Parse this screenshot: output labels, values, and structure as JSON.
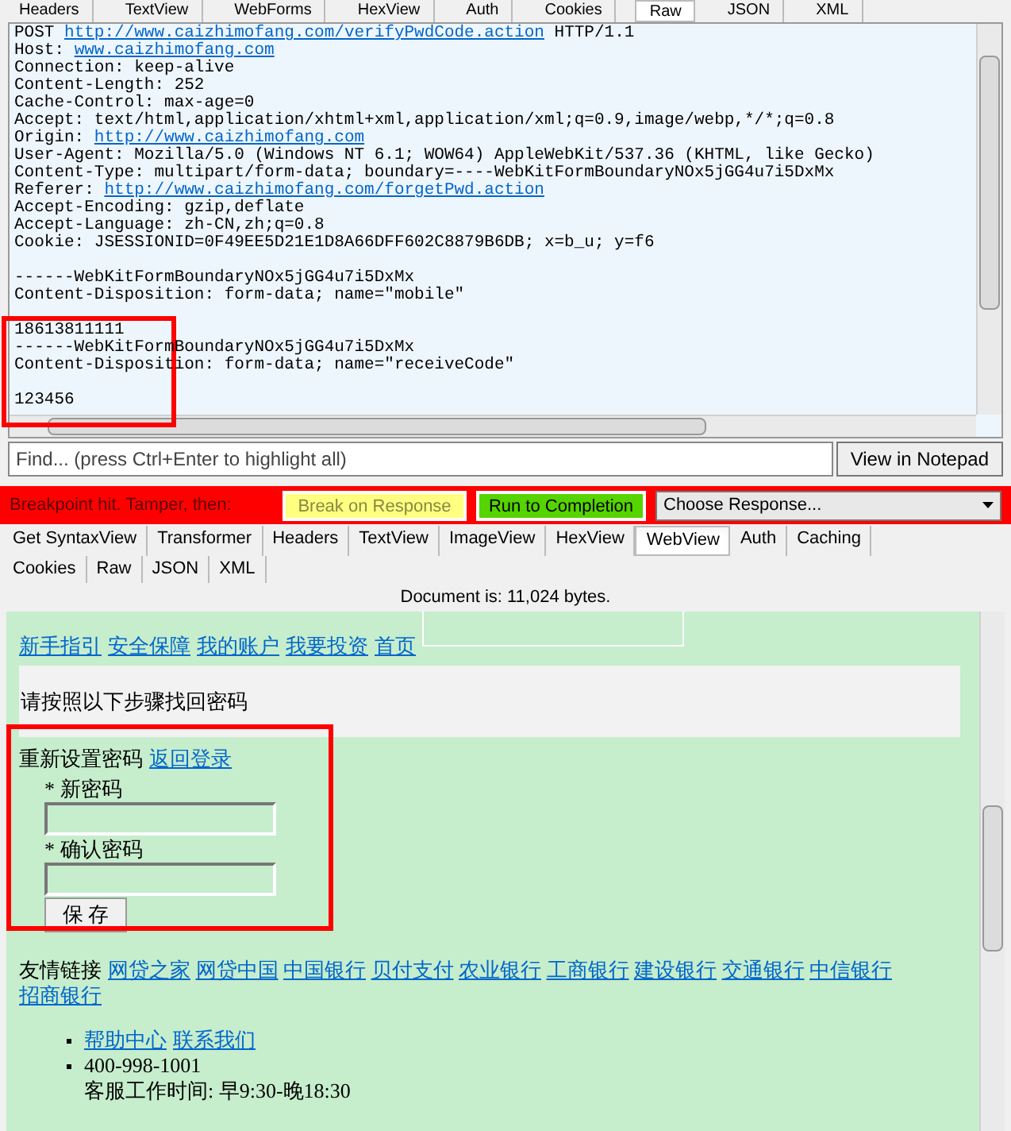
{
  "request_tabs": [
    {
      "label": "Headers",
      "selected": false
    },
    {
      "label": "TextView",
      "selected": false
    },
    {
      "label": "WebForms",
      "selected": false
    },
    {
      "label": "HexView",
      "selected": false
    },
    {
      "label": "Auth",
      "selected": false
    },
    {
      "label": "Cookies",
      "selected": false
    },
    {
      "label": "Raw",
      "selected": true
    },
    {
      "label": "JSON",
      "selected": false
    },
    {
      "label": "XML",
      "selected": false
    }
  ],
  "request_lines": [
    {
      "gap_before": false,
      "parts": [
        {
          "text": "POST ",
          "link": false
        },
        {
          "text": "http://www.caizhimofang.com/verifyPwdCode.action",
          "link": true
        },
        {
          "text": " HTTP/1.1",
          "link": false
        }
      ]
    },
    {
      "gap_before": false,
      "parts": [
        {
          "text": "Host: ",
          "link": false
        },
        {
          "text": "www.caizhimofang.com",
          "link": true
        }
      ]
    },
    {
      "gap_before": false,
      "parts": [
        {
          "text": "Connection: keep-alive",
          "link": false
        }
      ]
    },
    {
      "gap_before": false,
      "parts": [
        {
          "text": "Content-Length: 252",
          "link": false
        }
      ]
    },
    {
      "gap_before": false,
      "parts": [
        {
          "text": "Cache-Control: max-age=0",
          "link": false
        }
      ]
    },
    {
      "gap_before": false,
      "parts": [
        {
          "text": "Accept: text/html,application/xhtml+xml,application/xml;q=0.9,image/webp,*/*;q=0.8",
          "link": false
        }
      ]
    },
    {
      "gap_before": false,
      "parts": [
        {
          "text": "Origin: ",
          "link": false
        },
        {
          "text": "http://www.caizhimofang.com",
          "link": true
        }
      ]
    },
    {
      "gap_before": false,
      "parts": [
        {
          "text": "User-Agent: Mozilla/5.0 (Windows NT 6.1; WOW64) AppleWebKit/537.36 (KHTML, like Gecko)",
          "link": false
        }
      ]
    },
    {
      "gap_before": false,
      "parts": [
        {
          "text": "Content-Type: multipart/form-data; boundary=----WebKitFormBoundaryNOx5jGG4u7i5DxMx",
          "link": false
        }
      ]
    },
    {
      "gap_before": false,
      "parts": [
        {
          "text": "Referer: ",
          "link": false
        },
        {
          "text": "http://www.caizhimofang.com/forgetPwd.action",
          "link": true
        }
      ]
    },
    {
      "gap_before": false,
      "parts": [
        {
          "text": "Accept-Encoding: gzip,deflate",
          "link": false
        }
      ]
    },
    {
      "gap_before": false,
      "parts": [
        {
          "text": "Accept-Language: zh-CN,zh;q=0.8",
          "link": false
        }
      ]
    },
    {
      "gap_before": false,
      "parts": [
        {
          "text": "Cookie: JSESSIONID=0F49EE5D21E1D8A66DFF602C8879B6DB; x=b_u; y=f6",
          "link": false
        }
      ]
    },
    {
      "gap_before": true,
      "parts": [
        {
          "text": "------WebKitFormBoundaryNOx5jGG4u7i5DxMx",
          "link": false
        }
      ]
    },
    {
      "gap_before": false,
      "parts": [
        {
          "text": "Content-Disposition: form-data; name=\"mobile\"",
          "link": false
        }
      ]
    },
    {
      "gap_before": true,
      "parts": [
        {
          "text": "18613811111",
          "link": false
        }
      ]
    },
    {
      "gap_before": false,
      "parts": [
        {
          "text": "------WebKitFormBoundaryNOx5jGG4u7i5DxMx",
          "link": false
        }
      ]
    },
    {
      "gap_before": false,
      "parts": [
        {
          "text": "Content-Disposition: form-data; name=\"receiveCode\"",
          "link": false
        }
      ]
    },
    {
      "gap_before": true,
      "parts": [
        {
          "text": "123456",
          "link": false
        }
      ]
    }
  ],
  "find": {
    "placeholder": "Find... (press Ctrl+Enter to highlight all)",
    "button": "View in Notepad"
  },
  "breakpoint": {
    "message": "Breakpoint hit. Tamper, then:",
    "break_on_response": {
      "label": "Break on Response",
      "disabled": true
    },
    "run_to_completion": "Run to Completion",
    "choose_response": "Choose Response..."
  },
  "response_tabs": [
    [
      {
        "label": "Get SyntaxView",
        "selected": false
      },
      {
        "label": "Transformer",
        "selected": false
      },
      {
        "label": "Headers",
        "selected": false
      },
      {
        "label": "TextView",
        "selected": false
      },
      {
        "label": "ImageView",
        "selected": false
      },
      {
        "label": "HexView",
        "selected": false
      },
      {
        "label": "WebView",
        "selected": true
      },
      {
        "label": "Auth",
        "selected": false
      },
      {
        "label": "Caching",
        "selected": false
      }
    ],
    [
      {
        "label": "Cookies",
        "selected": false
      },
      {
        "label": "Raw",
        "selected": false
      },
      {
        "label": "JSON",
        "selected": false
      },
      {
        "label": "XML",
        "selected": false
      }
    ]
  ],
  "document_size": "Document is: 11,024 bytes.",
  "webview": {
    "nav_links": [
      "新手指引",
      "安全保障",
      "我的账户",
      "我要投资",
      "首页"
    ],
    "notice": "请按照以下步骤找回密码",
    "reset_title": "重新设置密码",
    "back_link": "返回登录",
    "fields": [
      {
        "label": "* 新密码"
      },
      {
        "label": "* 确认密码"
      }
    ],
    "save_button": "保 存",
    "friend_links_label": "友情链接",
    "friend_links": [
      "网贷之家",
      "网贷中国",
      "中国银行",
      "贝付支付",
      "农业银行",
      "工商银行",
      "建设银行",
      "交通银行",
      "中信银行",
      "招商银行"
    ],
    "footer_items": [
      {
        "links": [
          "帮助中心",
          "联系我们"
        ]
      },
      {
        "lines": [
          "400-998-1001",
          "客服工作时间: 早9:30-晚18:30"
        ]
      }
    ]
  }
}
